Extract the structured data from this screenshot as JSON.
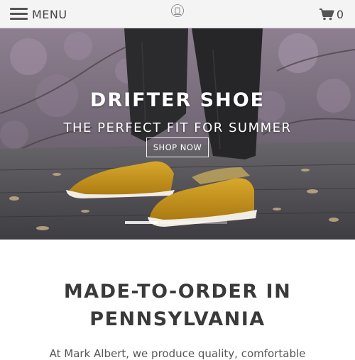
{
  "header": {
    "menu_label": "MENU",
    "cart_count": "0",
    "icons": {
      "menu": "hamburger-icon",
      "cart": "shopping-cart-icon",
      "logo": "brand-logo"
    }
  },
  "hero": {
    "title": "DRIFTER SHOE",
    "subtitle": "THE PERFECT FIT FOR SUMMER",
    "cta_label": "SHOP NOW",
    "slide_count": 3,
    "active_slide": 1
  },
  "intro": {
    "title_line1": "MADE-TO-ORDER IN",
    "title_line2": "PENNSYLVANIA",
    "body": "At Mark Albert, we produce quality, comfortable"
  },
  "colors": {
    "header_bg": "#f4f4f4",
    "shoe_mustard": "#c9961a",
    "sole_white": "#f2efe8",
    "text_dark": "#3a3a3a"
  }
}
